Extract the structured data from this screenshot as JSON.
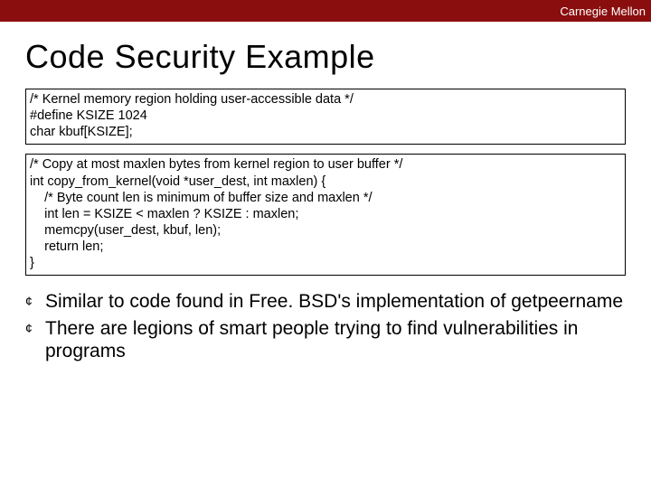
{
  "header": {
    "brand": "Carnegie Mellon"
  },
  "title": "Code Security Example",
  "code_block_1": "/* Kernel memory region holding user-accessible data */\n#define KSIZE 1024\nchar kbuf[KSIZE];",
  "code_block_2": "/* Copy at most maxlen bytes from kernel region to user buffer */\nint copy_from_kernel(void *user_dest, int maxlen) {\n    /* Byte count len is minimum of buffer size and maxlen */\n    int len = KSIZE < maxlen ? KSIZE : maxlen;\n    memcpy(user_dest, kbuf, len);\n    return len;\n}",
  "bullets": [
    "Similar to code found in Free. BSD's implementation of getpeername",
    "There are legions of smart people trying to find vulnerabilities in programs"
  ]
}
